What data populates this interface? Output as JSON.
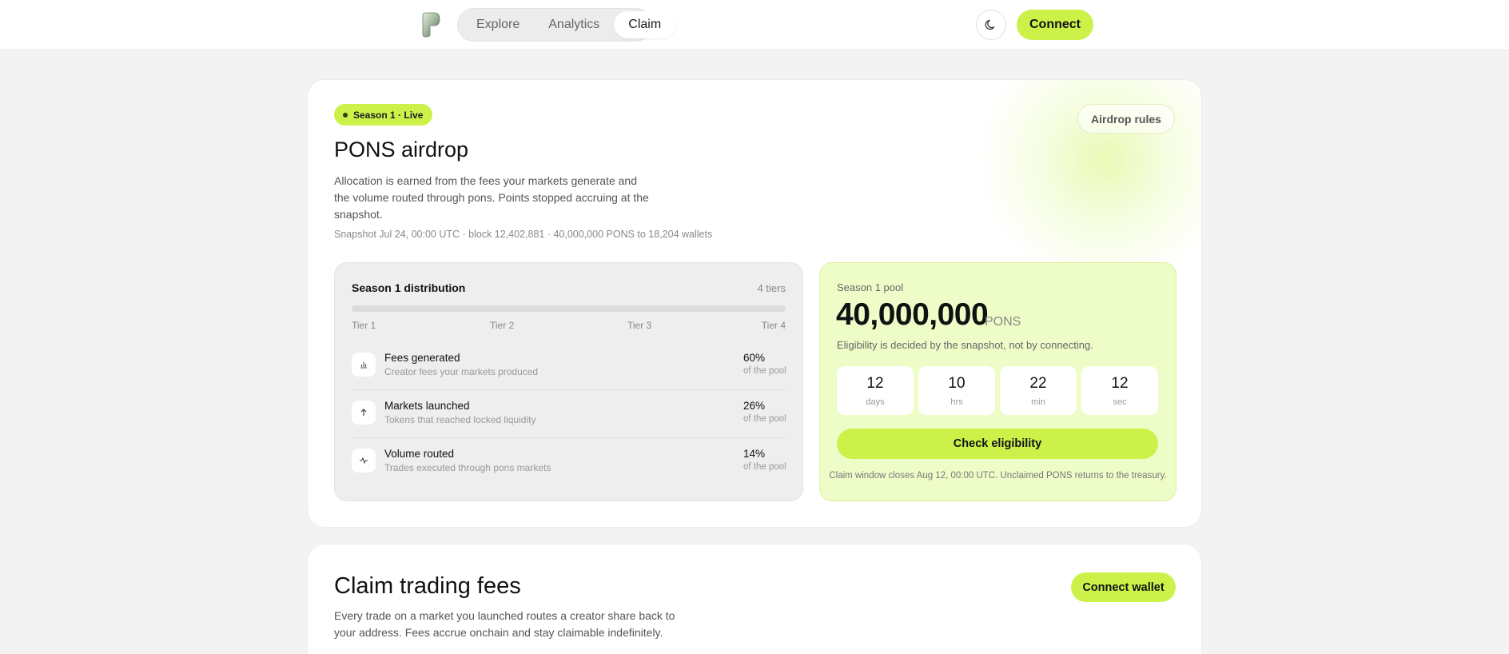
{
  "nav": {
    "logo_icon": "pons-logo-icon",
    "items": [
      {
        "label": "Explore",
        "active": false
      },
      {
        "label": "Analytics",
        "active": false
      },
      {
        "label": "Claim",
        "active": true
      }
    ],
    "theme_icon": "moon-icon",
    "connect_label": "Connect"
  },
  "airdrop": {
    "badge": "Season 1 · Live",
    "rules_label": "Airdrop rules",
    "title": "PONS airdrop",
    "description": "Allocation is earned from the fees your markets generate and the volume routed through pons. Points stopped accruing at the snapshot.",
    "snapshot": "Snapshot Jul 24, 00:00 UTC · block 12,402,881 · 40,000,000 PONS to 18,204 wallets",
    "distribution": {
      "title": "Season 1 distribution",
      "tier_count": "4 tiers",
      "tiers": [
        "Tier 1",
        "Tier 2",
        "Tier 3",
        "Tier 4"
      ],
      "rows": [
        {
          "icon": "bar-chart-icon",
          "name": "Fees generated",
          "sub": "Creator fees your markets produced",
          "pct": "60%",
          "pool": "of the pool"
        },
        {
          "icon": "arrow-up-icon",
          "name": "Markets launched",
          "sub": "Tokens that reached locked liquidity",
          "pct": "26%",
          "pool": "of the pool"
        },
        {
          "icon": "activity-icon",
          "name": "Volume routed",
          "sub": "Trades executed through pons markets",
          "pct": "14%",
          "pool": "of the pool"
        }
      ]
    },
    "pool": {
      "label": "Season 1 pool",
      "amount": "40,000,000",
      "unit": "PONS",
      "note": "Eligibility is decided by the snapshot, not by connecting.",
      "countdown": [
        {
          "num": "12",
          "lbl": "days"
        },
        {
          "num": "10",
          "lbl": "hrs"
        },
        {
          "num": "22",
          "lbl": "min"
        },
        {
          "num": "12",
          "lbl": "sec"
        }
      ],
      "check_label": "Check eligibility",
      "footer": "Claim window closes Aug 12, 00:00 UTC. Unclaimed PONS returns to the treasury."
    }
  },
  "fees": {
    "title": "Claim trading fees",
    "description": "Every trade on a market you launched routes a creator share back to your address. Fees accrue onchain and stay claimable indefinitely.",
    "connect_wallet_label": "Connect wallet"
  },
  "colors": {
    "accent": "#ccf24a",
    "pool_bg": "#eefcc8"
  }
}
